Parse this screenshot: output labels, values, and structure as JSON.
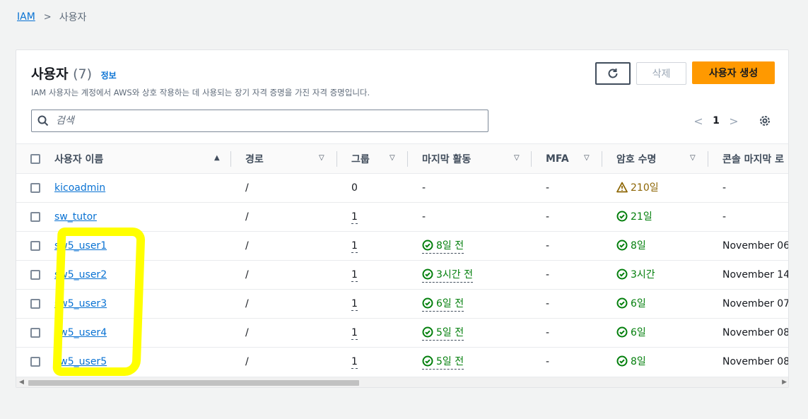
{
  "breadcrumb": {
    "root": "IAM",
    "separator": ">",
    "current": "사용자"
  },
  "header": {
    "title": "사용자",
    "count": "(7)",
    "info": "정보",
    "description": "IAM 사용자는 계정에서 AWS와 상호 작용하는 데 사용되는 장기 자격 증명을 가진 자격 증명입니다.",
    "delete_label": "삭제",
    "create_label": "사용자 생성"
  },
  "search": {
    "placeholder": "검색"
  },
  "pagination": {
    "prev": "<",
    "page": "1",
    "next": ">"
  },
  "columns": [
    "사용자 이름",
    "경로",
    "그룹",
    "마지막 활동",
    "MFA",
    "암호 수명",
    "콘솔 마지막 로"
  ],
  "sort_indicator": "▲",
  "filter_indicator": "▽",
  "rows": [
    {
      "name": "kicoadmin",
      "path": "/",
      "groups": "0",
      "last_activity": "-",
      "mfa": "-",
      "password_age": "210일",
      "password_status": "warning",
      "console_last": "-"
    },
    {
      "name": "sw_tutor",
      "path": "/",
      "groups": "1",
      "last_activity": "-",
      "mfa": "-",
      "password_age": "21일",
      "password_status": "ok",
      "console_last": "-"
    },
    {
      "name": "sw5_user1",
      "path": "/",
      "groups": "1",
      "last_activity": "8일 전",
      "mfa": "-",
      "password_age": "8일",
      "password_status": "ok",
      "console_last": "November 06,"
    },
    {
      "name": "sw5_user2",
      "path": "/",
      "groups": "1",
      "last_activity": "3시간 전",
      "mfa": "-",
      "password_age": "3시간",
      "password_status": "ok",
      "console_last": "November 14,"
    },
    {
      "name": "sw5_user3",
      "path": "/",
      "groups": "1",
      "last_activity": "6일 전",
      "mfa": "-",
      "password_age": "6일",
      "password_status": "ok",
      "console_last": "November 07,"
    },
    {
      "name": "sw5_user4",
      "path": "/",
      "groups": "1",
      "last_activity": "5일 전",
      "mfa": "-",
      "password_age": "6일",
      "password_status": "ok",
      "console_last": "November 08,"
    },
    {
      "name": "sw5_user5",
      "path": "/",
      "groups": "1",
      "last_activity": "5일 전",
      "mfa": "-",
      "password_age": "8일",
      "password_status": "ok",
      "console_last": "November 08,"
    }
  ],
  "colors": {
    "link": "#0972d3",
    "primary": "#ff9900",
    "success": "#037f0c",
    "warning": "#8d6605",
    "highlight": "#ffff00"
  }
}
